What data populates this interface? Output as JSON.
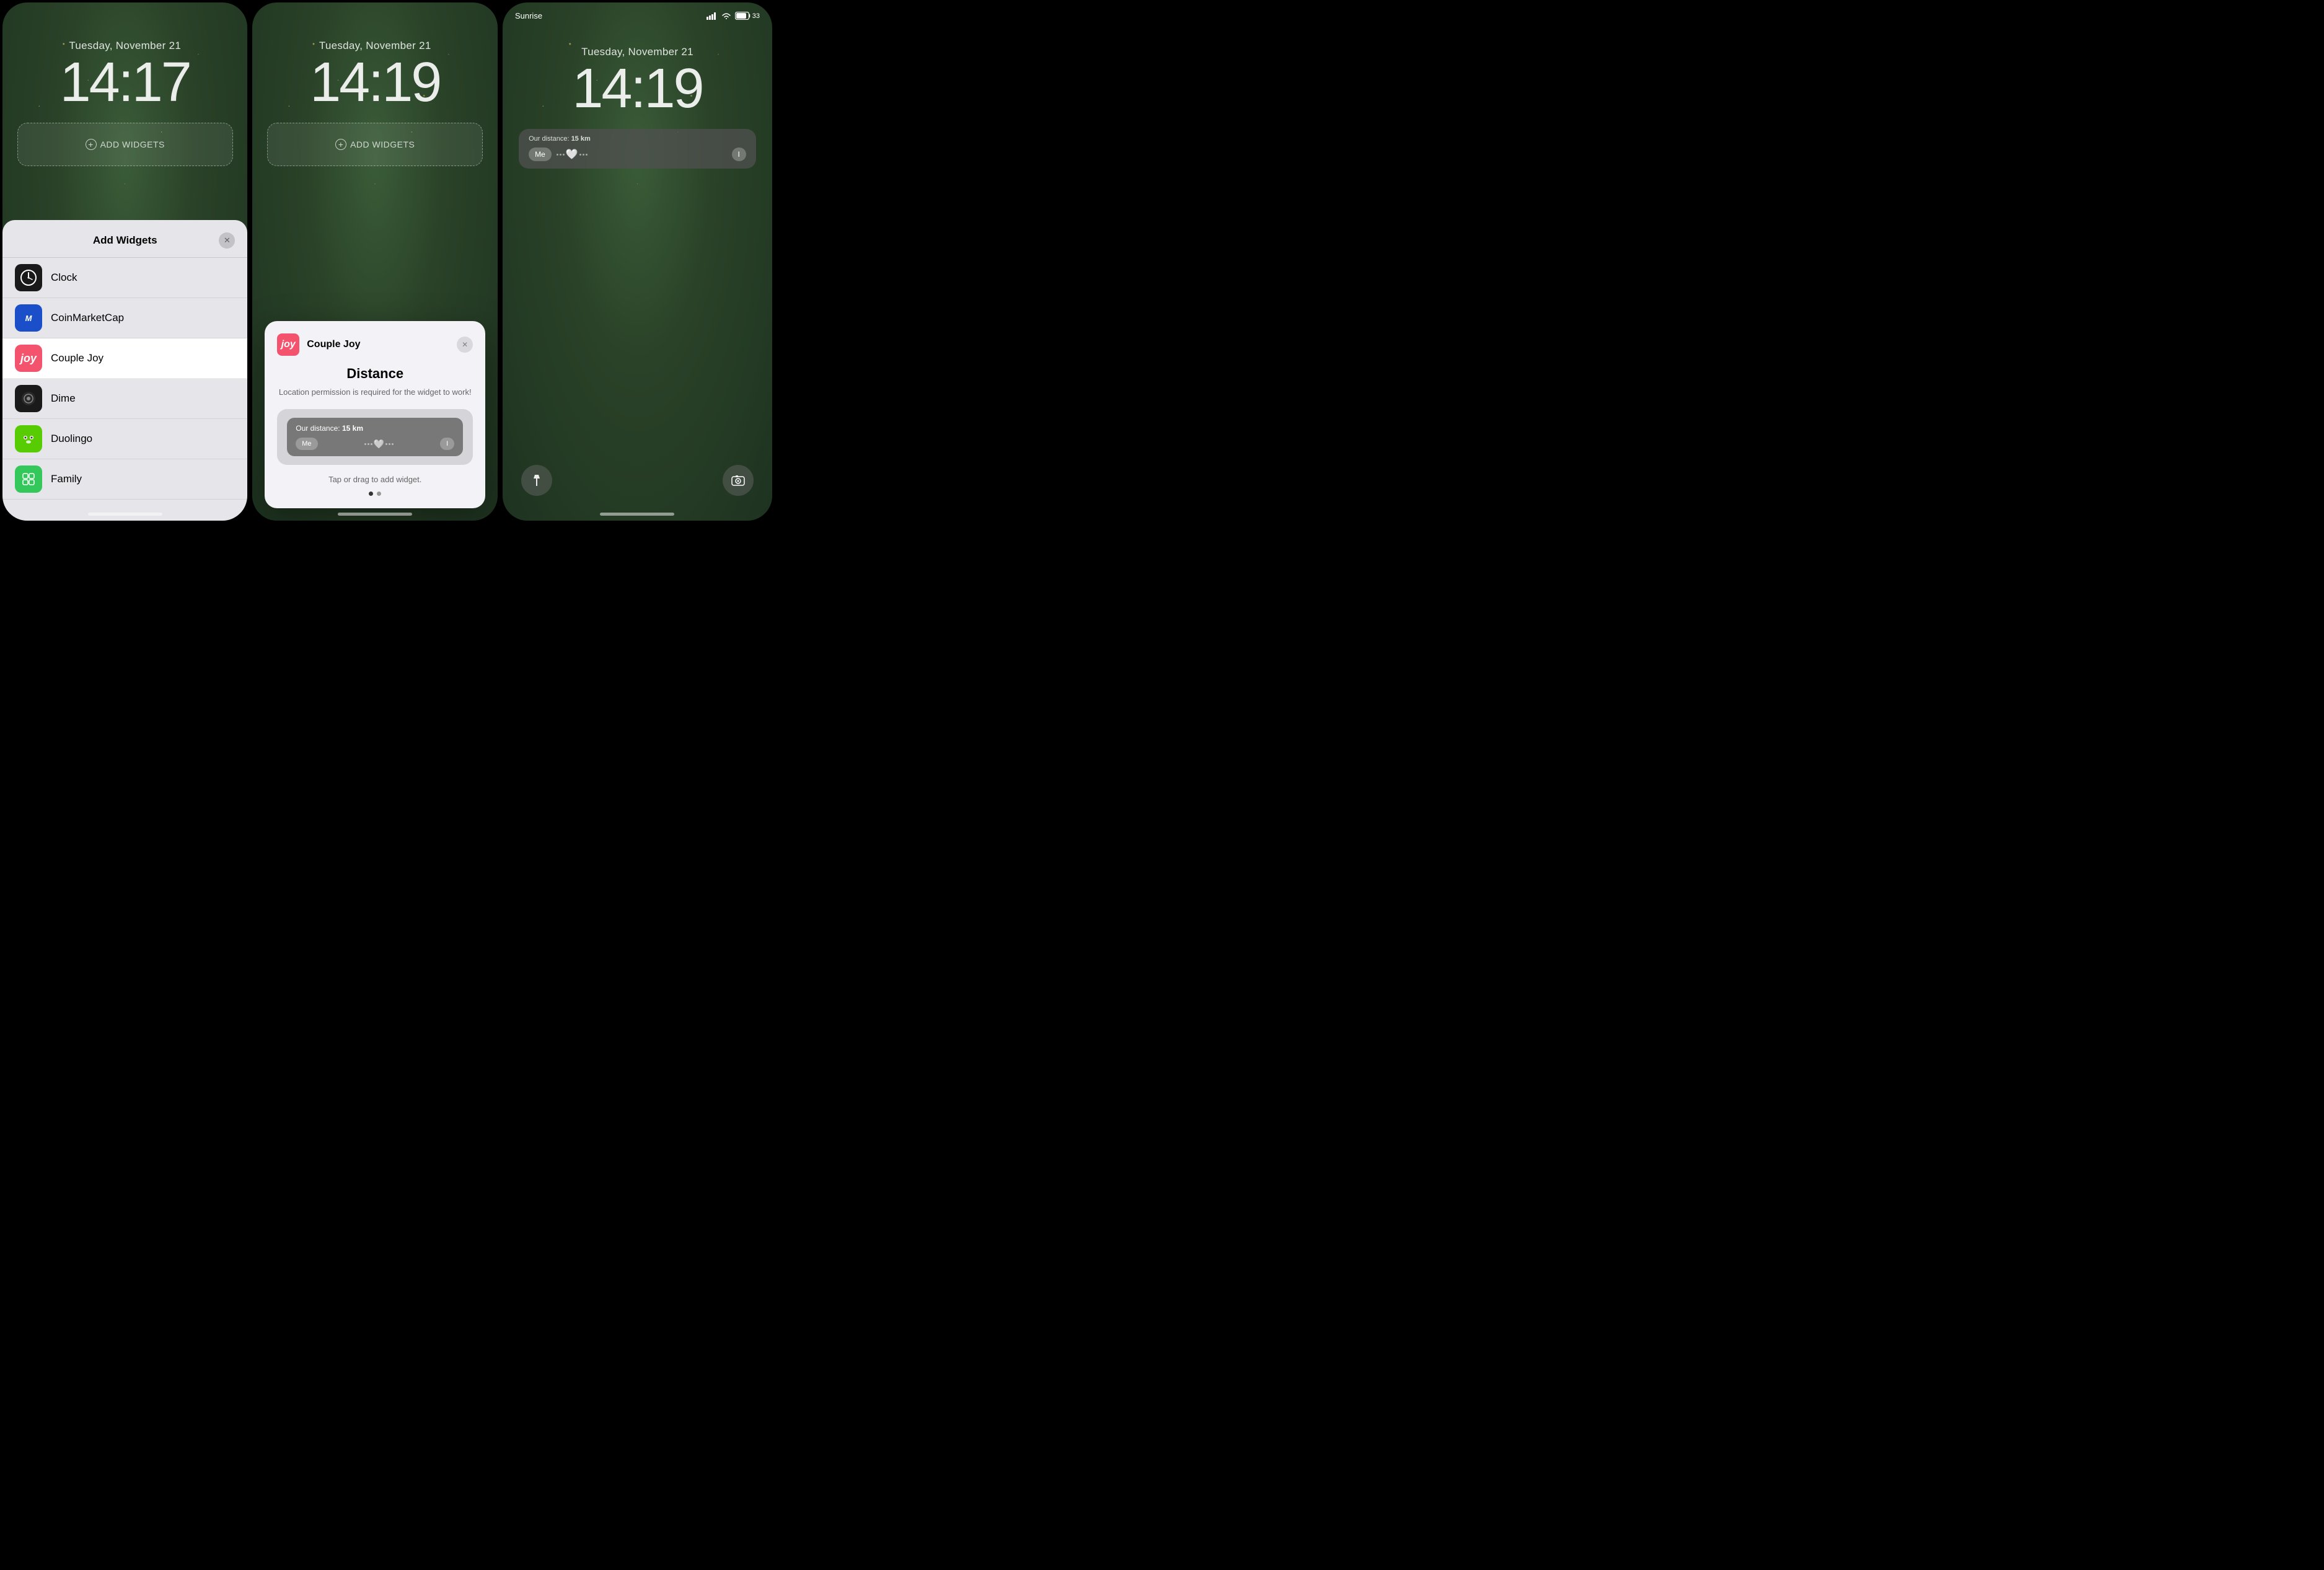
{
  "panels": {
    "panel1": {
      "date": "Tuesday, November 21",
      "time": "14:17",
      "add_widgets_label": "ADD WIDGETS",
      "sheet": {
        "title": "Add Widgets",
        "apps": [
          {
            "id": "clock",
            "name": "Clock",
            "icon_type": "clock"
          },
          {
            "id": "coinmarketcap",
            "name": "CoinMarketCap",
            "icon_type": "coinmarket"
          },
          {
            "id": "couplejoy",
            "name": "Couple Joy",
            "icon_type": "couplejoy",
            "selected": true
          },
          {
            "id": "dime",
            "name": "Dime",
            "icon_type": "dime"
          },
          {
            "id": "duolingo",
            "name": "Duolingo",
            "icon_type": "duolingo"
          },
          {
            "id": "family",
            "name": "Family",
            "icon_type": "family"
          }
        ]
      }
    },
    "panel2": {
      "date": "Tuesday, November 21",
      "time": "14:19",
      "add_widgets_label": "ADD WIDGETS",
      "modal": {
        "app_name": "Couple Joy",
        "title": "Distance",
        "subtitle": "Location permission is required for the widget to work!",
        "distance_label": "Our distance:",
        "distance_value": "15 km",
        "me_label": "Me",
        "partner_label": "I",
        "tap_label": "Tap or drag to add widget.",
        "page_dots": [
          true,
          false
        ]
      }
    },
    "panel3": {
      "status_carrier": "Sunrise",
      "date": "Tuesday, November 21",
      "time": "14:19",
      "widget": {
        "distance_label": "Our distance:",
        "distance_value": "15 km",
        "me_label": "Me",
        "partner_label": "I"
      }
    }
  },
  "icons": {
    "plus": "+",
    "close": "✕",
    "flashlight": "🔦",
    "camera": "📷",
    "heart": "🤍"
  }
}
